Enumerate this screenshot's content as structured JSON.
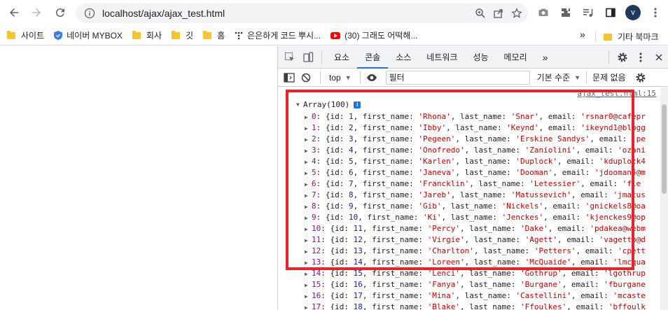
{
  "browser": {
    "url": "localhost/ajax/ajax_test.html",
    "avatar_letter": "v"
  },
  "bookmarks": {
    "items": [
      {
        "label": "사이트",
        "icon": "folder-icon"
      },
      {
        "label": "네이버 MYBOX",
        "icon": "shield-icon"
      },
      {
        "label": "회사",
        "icon": "folder-icon"
      },
      {
        "label": "깃",
        "icon": "folder-icon"
      },
      {
        "label": "홈",
        "icon": "folder-icon"
      },
      {
        "label": "은은하게 코드 뿌시...",
        "icon": "dots-icon"
      },
      {
        "label": "(30) 그래도 어떡해...",
        "icon": "youtube-icon"
      }
    ],
    "more": "»",
    "other_label": "기타 북마크"
  },
  "devtools": {
    "tabs": [
      "요소",
      "콘솔",
      "소스",
      "네트워크",
      "성능",
      "메모리"
    ],
    "active_tab": "콘솔",
    "more_tabs": "»",
    "context": "top",
    "filter_placeholder": "필터",
    "levels_label": "기본 수준",
    "issues_label": "문제 없음"
  },
  "console": {
    "source_link": "ajax_test.html:15",
    "array_label": "Array(100)",
    "info_badge": "i",
    "rows": [
      {
        "idx": "0",
        "id": "1",
        "first_name": "'Rhona'",
        "last_name": "'Snar'",
        "email": "'rsnar0@cafepr"
      },
      {
        "idx": "1",
        "id": "2",
        "first_name": "'Ibby'",
        "last_name": "'Keynd'",
        "email": "'ikeynd1@blogg"
      },
      {
        "idx": "2",
        "id": "3",
        "first_name": "'Pegeen'",
        "last_name": "'Erskine Sandys'",
        "email": "'pe"
      },
      {
        "idx": "3",
        "id": "4",
        "first_name": "'Onofredo'",
        "last_name": "'Zaniolini'",
        "email": "'ozani"
      },
      {
        "idx": "4",
        "id": "5",
        "first_name": "'Karlen'",
        "last_name": "'Duplock'",
        "email": "'kduplock4"
      },
      {
        "idx": "5",
        "id": "6",
        "first_name": "'Janeva'",
        "last_name": "'Dooman'",
        "email": "'jdooman5@m"
      },
      {
        "idx": "6",
        "id": "7",
        "first_name": "'Francklin'",
        "last_name": "'Letessier'",
        "email": "'fle"
      },
      {
        "idx": "7",
        "id": "8",
        "first_name": "'Jareb'",
        "last_name": "'Matussevich'",
        "email": "'jmatus"
      },
      {
        "idx": "8",
        "id": "9",
        "first_name": "'Gib'",
        "last_name": "'Nickels'",
        "email": "'gnickels8@oa"
      },
      {
        "idx": "9",
        "id": "10",
        "first_name": "'Ki'",
        "last_name": "'Jenckes'",
        "email": "'kjenckes9@op"
      },
      {
        "idx": "10",
        "id": "11",
        "first_name": "'Percy'",
        "last_name": "'Dake'",
        "email": "'pdakea@webm"
      },
      {
        "idx": "11",
        "id": "12",
        "first_name": "'Virgie'",
        "last_name": "'Agett'",
        "email": "'vagettb@d"
      },
      {
        "idx": "12",
        "id": "13",
        "first_name": "'Charlton'",
        "last_name": "'Petters'",
        "email": "'cpett"
      },
      {
        "idx": "13",
        "id": "14",
        "first_name": "'Loreen'",
        "last_name": "'McQuaide'",
        "email": "'lmcqua"
      },
      {
        "idx": "14",
        "id": "15",
        "first_name": "'Lenci'",
        "last_name": "'Gothrup'",
        "email": "'lgothrup"
      },
      {
        "idx": "15",
        "id": "16",
        "first_name": "'Fanya'",
        "last_name": "'Burgane'",
        "email": "'fburgane"
      },
      {
        "idx": "16",
        "id": "17",
        "first_name": "'Mina'",
        "last_name": "'Castellini'",
        "email": "'mcaste"
      },
      {
        "idx": "17",
        "id": "18",
        "first_name": "'Blake'",
        "last_name": "'Ffoulkes'",
        "email": "'bffoulk"
      }
    ]
  },
  "colors": {
    "highlight": "#e8232a",
    "tab_active": "#1a73e8",
    "string": "#c80000",
    "number": "#1a1aa6",
    "index": "#881280"
  }
}
